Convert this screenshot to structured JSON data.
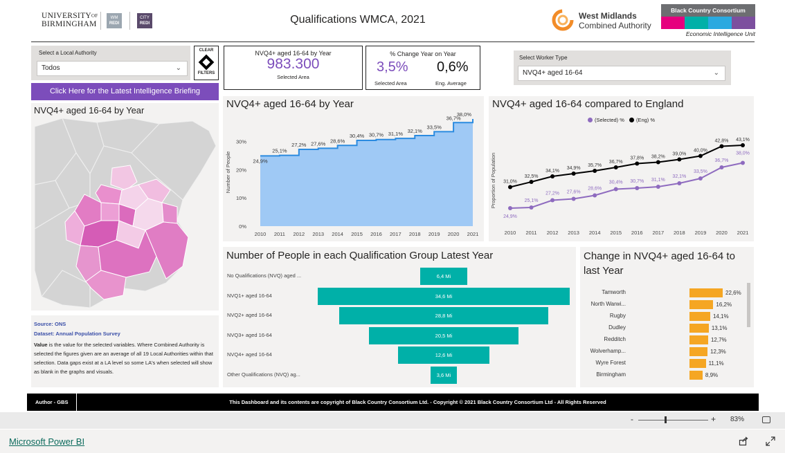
{
  "header": {
    "uni_line1": "UNIVERSITY",
    "uni_of": "OF",
    "uni_line2": "BIRMINGHAM",
    "wm_redi_1": "WM",
    "wm_redi_2": "REDI",
    "city_redi_1": "CITY",
    "city_redi_2": "REDI",
    "title": "Qualifications WMCA, 2021",
    "wmca_line1": "West Midlands",
    "wmca_line2": "Combined Authority",
    "bcc_title": "Black Country Consortium",
    "bcc_sub": "Economic Intelligence Unit",
    "bcc_colors": [
      "#e6007e",
      "#00b0a8",
      "#2aa9e0",
      "#7c4f9e"
    ]
  },
  "filters": {
    "la_label": "Select a Local Authority",
    "la_value": "Todos",
    "clear_line1": "CLEAR",
    "clear_line2": "FILTERS",
    "worker_label": "Select Worker Type",
    "worker_value": "NVQ4+ aged 16-64"
  },
  "briefing_button": "Click Here for the Latest Intelligence Briefing",
  "kpi1": {
    "title": "NVQ4+ aged 16-64 by Year",
    "value": "983.300",
    "caption": "Selected Area"
  },
  "kpi2": {
    "title": "% Change Year on Year",
    "selected_value": "3,5%",
    "selected_caption": "Selected Area",
    "eng_value": "0,6%",
    "eng_caption": "Eng. Average"
  },
  "map": {
    "title": "NVQ4+ aged 16-64 by Year"
  },
  "notes": {
    "source": "Source: ONS",
    "dataset": "Dataset: Annual Population Survey",
    "value_word": "Value",
    "body": " is the value for the selected variables.  Where Combined Authority is selected the figures given are an average of all 19 Local Authorities within that selection.  Data gaps exist at a LA level so some LA's when selected will show as blank in the graphs and visuals."
  },
  "area_chart": {
    "title": "NVQ4+ aged 16-64 by Year",
    "ylabel": "Number of People",
    "yticks": [
      "0%",
      "10%",
      "20%",
      "30%"
    ]
  },
  "line_chart": {
    "title": "NVQ4+ aged 16-64 compared to England",
    "ylabel": "Proportion of Population",
    "legend_selected": "(Selected) %",
    "legend_eng": "(Eng) %",
    "color_selected": "#8e6bbf",
    "color_eng": "#000000"
  },
  "funnel_chart": {
    "title": "Number of People in each Qualification Group Latest Year"
  },
  "change_chart": {
    "title": "Change in NVQ4+ aged 16-64 to last Year"
  },
  "footer": {
    "author": "Author - GBS",
    "copyright": "This Dashboard and its contents are copyright of Black Country Consortium Ltd.  -  Copyright © 2021 Black Country Consortium Ltd - All Rights Reserved"
  },
  "statusbar": {
    "zoom_minus": "-",
    "zoom_plus": "+",
    "zoom": "83%"
  },
  "bottombar": {
    "link": "Microsoft Power BI"
  },
  "chart_data": [
    {
      "type": "area",
      "title": "NVQ4+ aged 16-64 by Year",
      "ylabel": "Number of People",
      "x": [
        2010,
        2011,
        2012,
        2013,
        2014,
        2015,
        2016,
        2017,
        2018,
        2019,
        2020,
        2021
      ],
      "values": [
        24.9,
        25.1,
        27.2,
        27.6,
        28.6,
        30.4,
        30.7,
        31.1,
        32.1,
        33.5,
        36.7,
        38.0
      ],
      "labels": [
        "24,9%",
        "25,1%",
        "27,2%",
        "27,6%",
        "28,6%",
        "30,4%",
        "30,7%",
        "31,1%",
        "32,1%",
        "33,5%",
        "36,7%",
        "38,0%"
      ],
      "ylim": [
        0,
        38
      ],
      "color": "#9fc9f5"
    },
    {
      "type": "line",
      "title": "NVQ4+ aged 16-64 compared to England",
      "ylabel": "Proportion of Population",
      "x": [
        2010,
        2011,
        2012,
        2013,
        2014,
        2015,
        2016,
        2017,
        2018,
        2019,
        2020,
        2021
      ],
      "series": [
        {
          "name": "(Selected) %",
          "values": [
            24.9,
            25.1,
            27.2,
            27.6,
            28.6,
            30.4,
            30.7,
            31.1,
            32.1,
            33.5,
            36.7,
            38.0
          ],
          "labels": [
            "24,9%",
            "25,1%",
            "27,2%",
            "27,6%",
            "28,6%",
            "30,4%",
            "30,7%",
            "31,1%",
            "32,1%",
            "33,5%",
            "36,7%",
            "38,0%"
          ]
        },
        {
          "name": "(Eng) %",
          "values": [
            31.0,
            32.5,
            34.1,
            34.9,
            35.7,
            36.7,
            37.8,
            38.2,
            39.0,
            40.0,
            42.8,
            43.1
          ],
          "labels": [
            "31,0%",
            "32,5%",
            "34,1%",
            "34,9%",
            "35,7%",
            "36,7%",
            "37,8%",
            "38,2%",
            "39,0%",
            "40,0%",
            "42,8%",
            "43,1%"
          ]
        }
      ]
    },
    {
      "type": "bar",
      "title": "Number of People in each Qualification Group Latest Year",
      "categories": [
        "No Qualifications (NVQ) aged ...",
        "NVQ1+ aged 16-64",
        "NVQ2+ aged 16-64",
        "NVQ3+ aged 16-64",
        "NVQ4+ aged 16-64",
        "Other Qualifications (NVQ) ag..."
      ],
      "values": [
        6.4,
        34.6,
        28.8,
        20.5,
        12.6,
        3.6
      ],
      "labels": [
        "6,4 Mi",
        "34,6 Mi",
        "28,8 Mi",
        "20,5 Mi",
        "12,6 Mi",
        "3,6 Mi"
      ]
    },
    {
      "type": "bar",
      "title": "Change in NVQ4+ aged 16-64 to last Year",
      "categories": [
        "Tamworth",
        "North Warwi...",
        "Rugby",
        "Dudley",
        "Redditch",
        "Wolverhamp...",
        "Wyre Forest",
        "Birmingham"
      ],
      "values": [
        22.6,
        16.2,
        14.1,
        13.1,
        12.7,
        12.3,
        11.1,
        8.9
      ],
      "labels": [
        "22,6%",
        "16,2%",
        "14,1%",
        "13,1%",
        "12,7%",
        "12,3%",
        "11,1%",
        "8,9%"
      ]
    }
  ]
}
